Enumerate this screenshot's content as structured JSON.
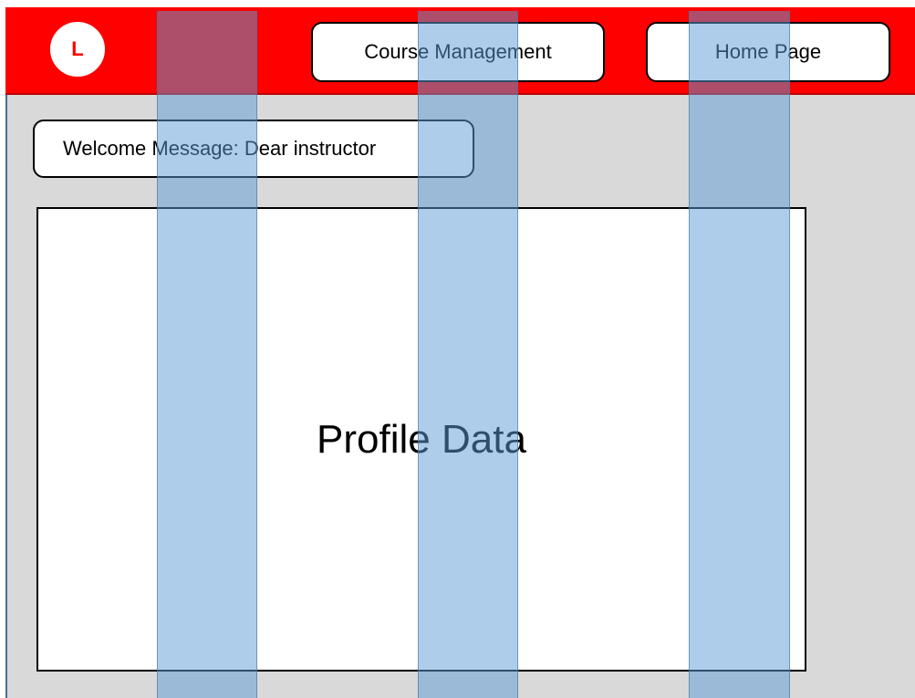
{
  "header": {
    "logo_letter": "L",
    "nav": {
      "course_management": "Course Management",
      "home_page": "Home Page"
    }
  },
  "welcome": {
    "text": "Welcome Message: Dear instructor"
  },
  "profile": {
    "text": "Profile Data"
  },
  "colors": {
    "header_bg": "#ff0000",
    "body_bg": "#d9d9d9",
    "column_overlay": "#5b9bd5"
  }
}
